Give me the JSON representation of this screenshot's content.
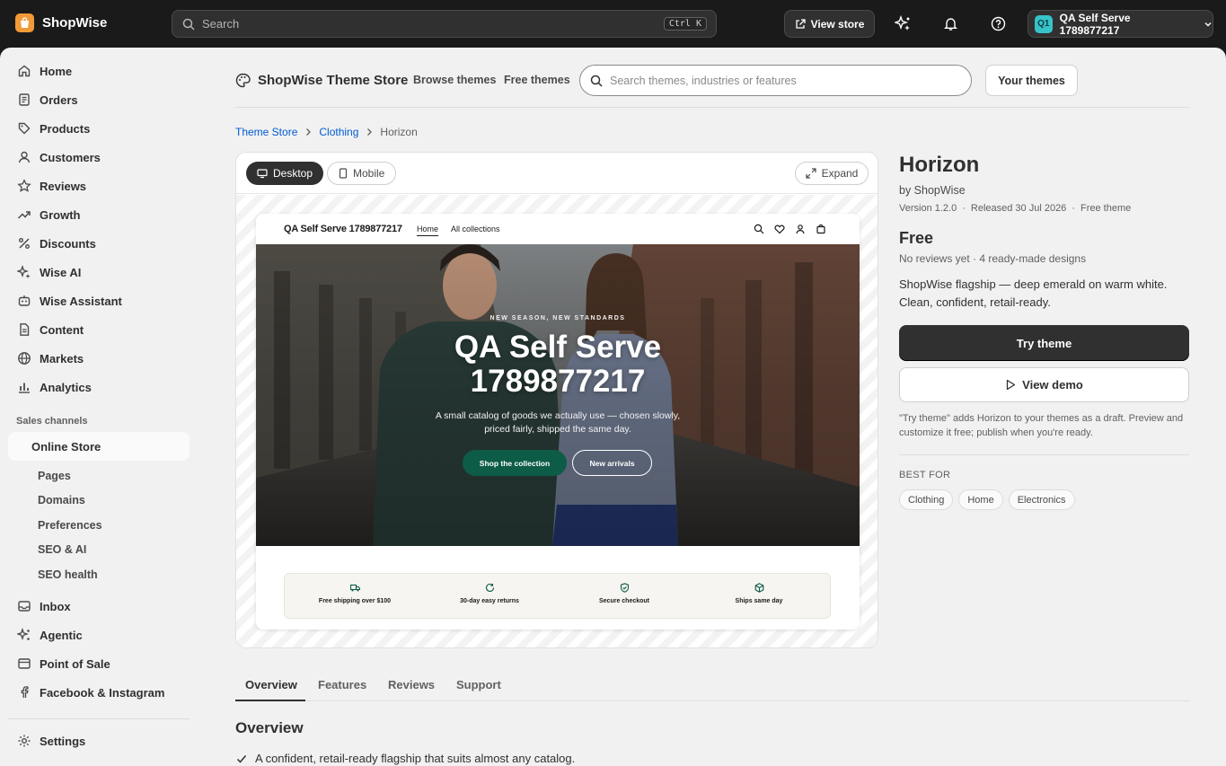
{
  "topbar": {
    "brand": "ShopWise",
    "search_placeholder": "Search",
    "shortcut": "Ctrl K",
    "view_store": "View store",
    "account_initials": "Q1",
    "account_name": "QA Self Serve 1789877217"
  },
  "sidebar": {
    "items": [
      {
        "label": "Home",
        "icon": "home-icon"
      },
      {
        "label": "Orders",
        "icon": "orders-icon"
      },
      {
        "label": "Products",
        "icon": "tag-icon"
      },
      {
        "label": "Customers",
        "icon": "person-icon"
      },
      {
        "label": "Reviews",
        "icon": "star-icon"
      },
      {
        "label": "Growth",
        "icon": "trend-icon"
      },
      {
        "label": "Discounts",
        "icon": "percent-icon"
      },
      {
        "label": "Wise AI",
        "icon": "sparkle-icon"
      },
      {
        "label": "Wise Assistant",
        "icon": "assistant-icon"
      },
      {
        "label": "Content",
        "icon": "document-icon"
      },
      {
        "label": "Markets",
        "icon": "globe-icon"
      },
      {
        "label": "Analytics",
        "icon": "bar-chart-icon"
      }
    ],
    "section_label": "Sales channels",
    "online_store": "Online Store",
    "sub_items": [
      "Pages",
      "Domains",
      "Preferences",
      "SEO & AI",
      "SEO health"
    ],
    "channels": [
      {
        "label": "Inbox",
        "icon": "inbox-icon"
      },
      {
        "label": "Agentic",
        "icon": "agentic-icon"
      },
      {
        "label": "Point of Sale",
        "icon": "pos-icon"
      },
      {
        "label": "Facebook & Instagram",
        "icon": "facebook-icon"
      }
    ],
    "settings": "Settings"
  },
  "theme_store": {
    "title": "ShopWise Theme Store",
    "browse": "Browse themes",
    "free": "Free themes",
    "search_placeholder": "Search themes, industries or features",
    "your_themes": "Your themes"
  },
  "breadcrumb": [
    "Theme Store",
    "Clothing",
    "Horizon"
  ],
  "preview": {
    "desktop": "Desktop",
    "mobile": "Mobile",
    "expand": "Expand",
    "mock": {
      "store_name": "QA Self Serve 1789877217",
      "nav": [
        "Home",
        "All collections"
      ],
      "eyebrow": "NEW SEASON, NEW STANDARDS",
      "hero_title_1": "QA Self Serve",
      "hero_title_2": "1789877217",
      "hero_sub": "A small catalog of goods we actually use — chosen slowly, priced fairly, shipped the same day.",
      "cta_primary": "Shop the collection",
      "cta_secondary": "New arrivals",
      "features": [
        "Free shipping over $100",
        "30-day easy returns",
        "Secure checkout",
        "Ships same day"
      ]
    }
  },
  "theme": {
    "name": "Horizon",
    "by": "by ShopWise",
    "version": "Version 1.2.0",
    "released": "Released 30 Jul 2026",
    "type": "Free theme",
    "price": "Free",
    "reviews": "No reviews yet · 4 ready-made designs",
    "description": "ShopWise flagship — deep emerald on warm white. Clean, confident, retail-ready.",
    "try_theme": "Try theme",
    "view_demo": "View demo",
    "note": "\"Try theme\" adds Horizon to your themes as a draft. Preview and customize it free; publish when you're ready.",
    "best_for_label": "BEST FOR",
    "best_for": [
      "Clothing",
      "Home",
      "Electronics"
    ]
  },
  "tabs": [
    "Overview",
    "Features",
    "Reviews",
    "Support"
  ],
  "overview": {
    "title": "Overview",
    "first_point": "A confident, retail-ready flagship that suits almost any catalog."
  },
  "colors": {
    "accent_emerald": "#0d5c47",
    "brand_orange": "#f29a38",
    "link_blue": "#005bd3"
  }
}
